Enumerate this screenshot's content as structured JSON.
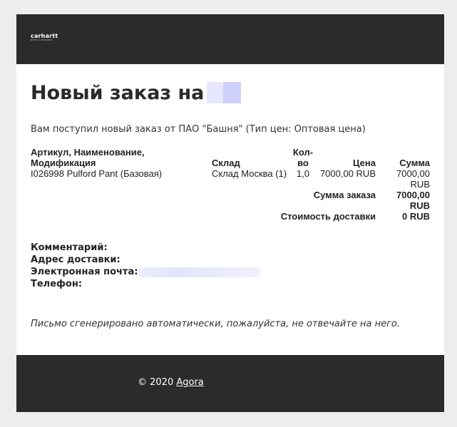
{
  "logo": {
    "word": "carhartt",
    "sub": "WORK IN PROGRESS"
  },
  "title": "Новый заказ на",
  "intro": "Вам поступил новый заказ от ПАО \"Башня\" (Тип цен: Оптовая цена)",
  "table": {
    "headers": {
      "name": "Артикул, Наименование, Модификация",
      "warehouse": "Склад",
      "qty": "Кол-во",
      "price": "Цена",
      "sum": "Сумма"
    },
    "rows": [
      {
        "name": "I026998 Pulford Pant (Базовая)",
        "warehouse": "Склад Москва (1)",
        "qty": "1,0",
        "price": "7000,00 RUB",
        "sum": "7000,00 RUB"
      }
    ],
    "order_total_label": "Сумма заказа",
    "order_total_value": "7000,00 RUB",
    "delivery_label": "Стоимость доставки",
    "delivery_value": "0 RUB"
  },
  "info": {
    "comment_label": "Комментарий:",
    "address_label": "Адрес доставки:",
    "email_label": "Электронная почта:",
    "phone_label": "Телефон:"
  },
  "note": "Письмо сгенерировано автоматически, пожалуйста, не отвечайте на него.",
  "footer": {
    "copyright": "© 2020",
    "link": "Agora"
  },
  "colors": {
    "header_bg": "#2b2b2d",
    "page_bg": "#ededed",
    "redaction": "#dcdcfc"
  }
}
